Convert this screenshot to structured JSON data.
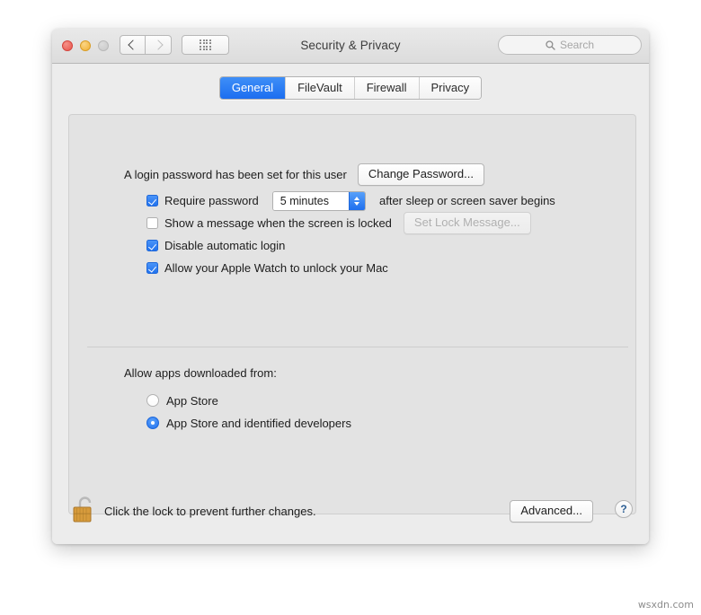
{
  "window": {
    "title": "Security & Privacy",
    "traffic_lights": [
      {
        "name": "close",
        "color": "#e8544b",
        "enabled": true
      },
      {
        "name": "minimize",
        "color": "#f0b034",
        "enabled": true
      },
      {
        "name": "zoom",
        "color": "#c9c9c9",
        "enabled": false
      }
    ],
    "nav": {
      "back_icon": "chevron-left-icon",
      "forward_icon": "chevron-right-icon",
      "back_enabled": true,
      "forward_enabled": false
    },
    "show_all_icon": "grid-icon"
  },
  "search": {
    "placeholder": "Search",
    "value": "",
    "icon": "search-icon"
  },
  "tabs": [
    {
      "label": "General",
      "active": true
    },
    {
      "label": "FileVault",
      "active": false
    },
    {
      "label": "Firewall",
      "active": false
    },
    {
      "label": "Privacy",
      "active": false
    }
  ],
  "general": {
    "password_status": "A login password has been set for this user",
    "change_password_label": "Change Password...",
    "require_password": {
      "checked": true,
      "label_before": "Require password",
      "interval_value": "5 minutes",
      "label_after": "after sleep or screen saver begins"
    },
    "show_message": {
      "checked": false,
      "label": "Show a message when the screen is locked",
      "button_label": "Set Lock Message...",
      "button_enabled": false
    },
    "disable_auto_login": {
      "checked": true,
      "label": "Disable automatic login"
    },
    "apple_watch_unlock": {
      "checked": true,
      "label": "Allow your Apple Watch to unlock your Mac"
    },
    "download_section": {
      "title": "Allow apps downloaded from:",
      "options": [
        {
          "label": "App Store",
          "selected": false
        },
        {
          "label": "App Store and identified developers",
          "selected": true
        }
      ]
    }
  },
  "footer": {
    "lock_icon": "unlocked-padlock-icon",
    "lock_note": "Click the lock to prevent further changes.",
    "advanced_label": "Advanced...",
    "help_label": "?"
  },
  "watermark": "wsxdn.com",
  "colors": {
    "accent_blue": "#2172ee",
    "window_bg": "#ececec",
    "panel_bg": "#e3e3e3",
    "lock_gold": "#d79b3c"
  }
}
